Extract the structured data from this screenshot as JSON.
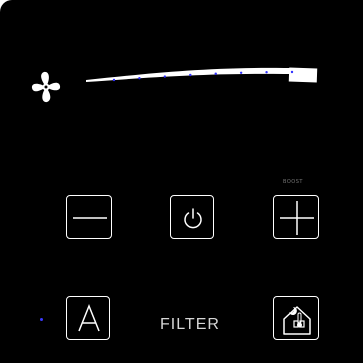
{
  "panel": {
    "background": "#000000",
    "foreground": "#ffffff"
  },
  "fan": {
    "icon": "fan-icon",
    "speed_level": 0.85,
    "speed_bar_dots": 8,
    "dot_color": "#3333ff"
  },
  "buttons": {
    "minus": {
      "icon": "minus-icon"
    },
    "power": {
      "icon": "power-icon"
    },
    "plus": {
      "icon": "plus-icon"
    },
    "auto": {
      "icon": "letter-a-icon",
      "glyph": "A"
    },
    "home": {
      "icon": "home-thermometer-icon"
    }
  },
  "labels": {
    "boost": "BOOST",
    "filter": "FILTER"
  },
  "indicators": {
    "auto_led_color": "#3a3aff"
  }
}
